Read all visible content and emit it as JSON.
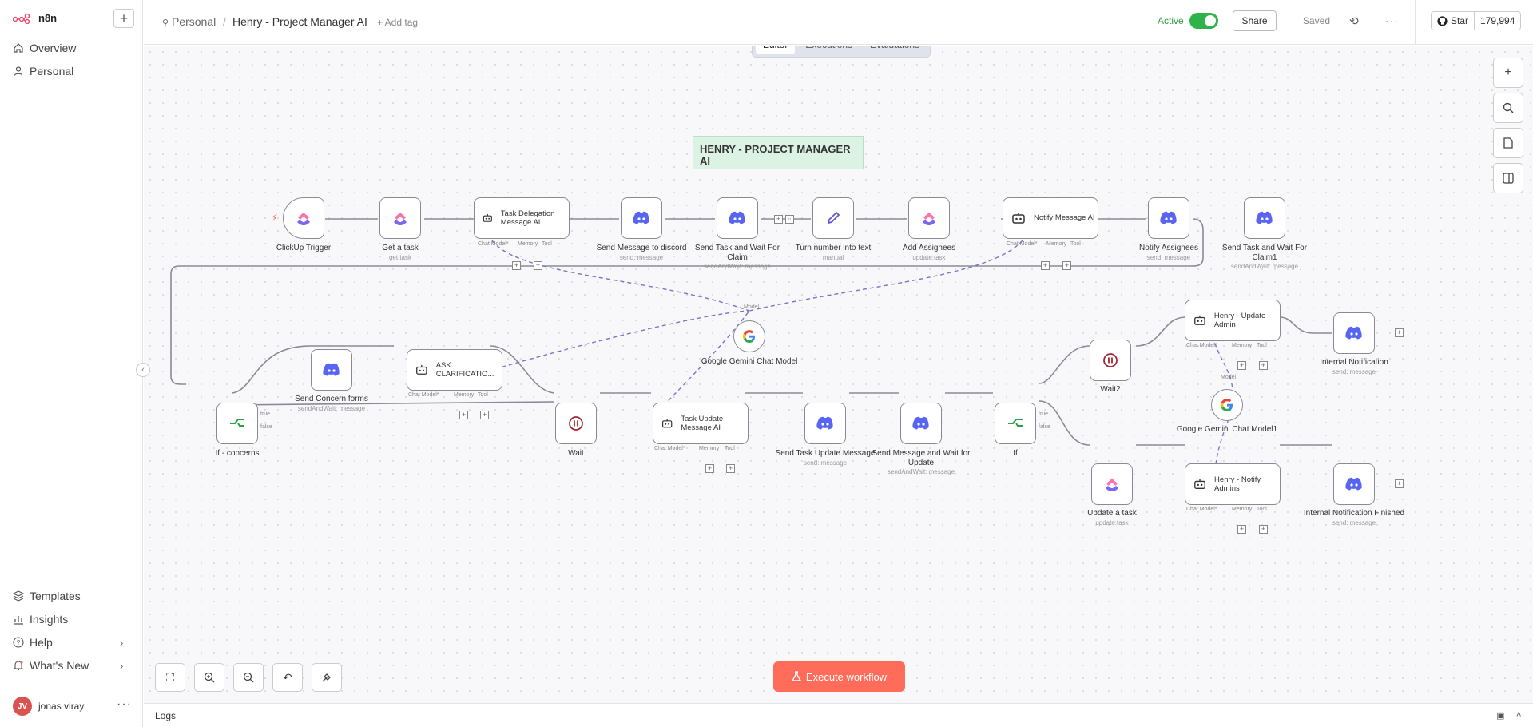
{
  "app": {
    "name": "n8n"
  },
  "sidebar": {
    "items": [
      {
        "label": "Overview",
        "icon": "home-icon"
      },
      {
        "label": "Personal",
        "icon": "user-icon"
      }
    ],
    "bottom": [
      {
        "label": "Templates",
        "icon": "templates-icon"
      },
      {
        "label": "Insights",
        "icon": "insights-icon"
      },
      {
        "label": "Help",
        "icon": "help-icon"
      },
      {
        "label": "What's New",
        "icon": "bell-icon"
      }
    ],
    "user": {
      "name": "jonas viray",
      "initials": "JV"
    }
  },
  "header": {
    "breadcrumb_project": "Personal",
    "breadcrumb_sep": "/",
    "workflow_name": "Henry - Project Manager AI",
    "add_tag": "+ Add tag",
    "active_label": "Active",
    "share_label": "Share",
    "saved_label": "Saved",
    "github_label": "Star",
    "github_count": "179,994"
  },
  "tabs": [
    {
      "label": "Editor",
      "active": true
    },
    {
      "label": "Executions",
      "active": false
    },
    {
      "label": "Evaluations",
      "active": false
    }
  ],
  "sticky": {
    "text": "HENRY - PROJECT MANAGER AI"
  },
  "nodes": {
    "n1": {
      "label": "ClickUp Trigger",
      "sub": ""
    },
    "n2": {
      "label": "Get a task",
      "sub": "get:task"
    },
    "n3": {
      "label": "Task Delegation Message AI",
      "sub": ""
    },
    "n4": {
      "label": "Send Message to discord",
      "sub": "send: message"
    },
    "n5": {
      "label": "Send Task and Wait For Claim",
      "sub": "sendAndWait: message"
    },
    "n6": {
      "label": "Turn number into text",
      "sub": "manual"
    },
    "n7": {
      "label": "Add Assignees",
      "sub": "update:task"
    },
    "n8": {
      "label": "Notify Message AI",
      "sub": ""
    },
    "n9": {
      "label": "Notify Assignees",
      "sub": "send: message"
    },
    "n10": {
      "label": "Send Task and Wait For Claim1",
      "sub": "sendAndWait: message"
    },
    "n11": {
      "label": "If - concerns",
      "sub": ""
    },
    "n12": {
      "label": "Send Concern forms",
      "sub": "sendAndWait: message"
    },
    "n13": {
      "label": "ASK CLARIFICATIO...",
      "sub": ""
    },
    "n14": {
      "label": "Google Gemini Chat Model",
      "sub": ""
    },
    "n15": {
      "label": "Wait",
      "sub": ""
    },
    "n16": {
      "label": "Task Update Message AI",
      "sub": ""
    },
    "n17": {
      "label": "Send Task Update Message",
      "sub": "send: message"
    },
    "n18": {
      "label": "Send Message and Wait for Update",
      "sub": "sendAndWait: message"
    },
    "n19": {
      "label": "If",
      "sub": ""
    },
    "n20": {
      "label": "Wait2",
      "sub": ""
    },
    "n21": {
      "label": "Henry - Update Admin",
      "sub": ""
    },
    "n22": {
      "label": "Internal Notification",
      "sub": "send: message"
    },
    "n23": {
      "label": "Google Gemini Chat Model1",
      "sub": ""
    },
    "n24": {
      "label": "Update a task",
      "sub": "update:task"
    },
    "n25": {
      "label": "Henry - Notify Admins",
      "sub": ""
    },
    "n26": {
      "label": "Internal Notification Finished",
      "sub": "send: message"
    }
  },
  "ports": {
    "chat_model": "Chat Model*",
    "memory": "Memory",
    "tool": "Tool",
    "model": "Model",
    "true": "true",
    "false": "false"
  },
  "execute_label": "Execute workflow",
  "logs_label": "Logs",
  "colors": {
    "accent": "#ff6d5a",
    "active": "#2db34a",
    "discord": "#5865f2",
    "clickup": "#7b68ee"
  }
}
